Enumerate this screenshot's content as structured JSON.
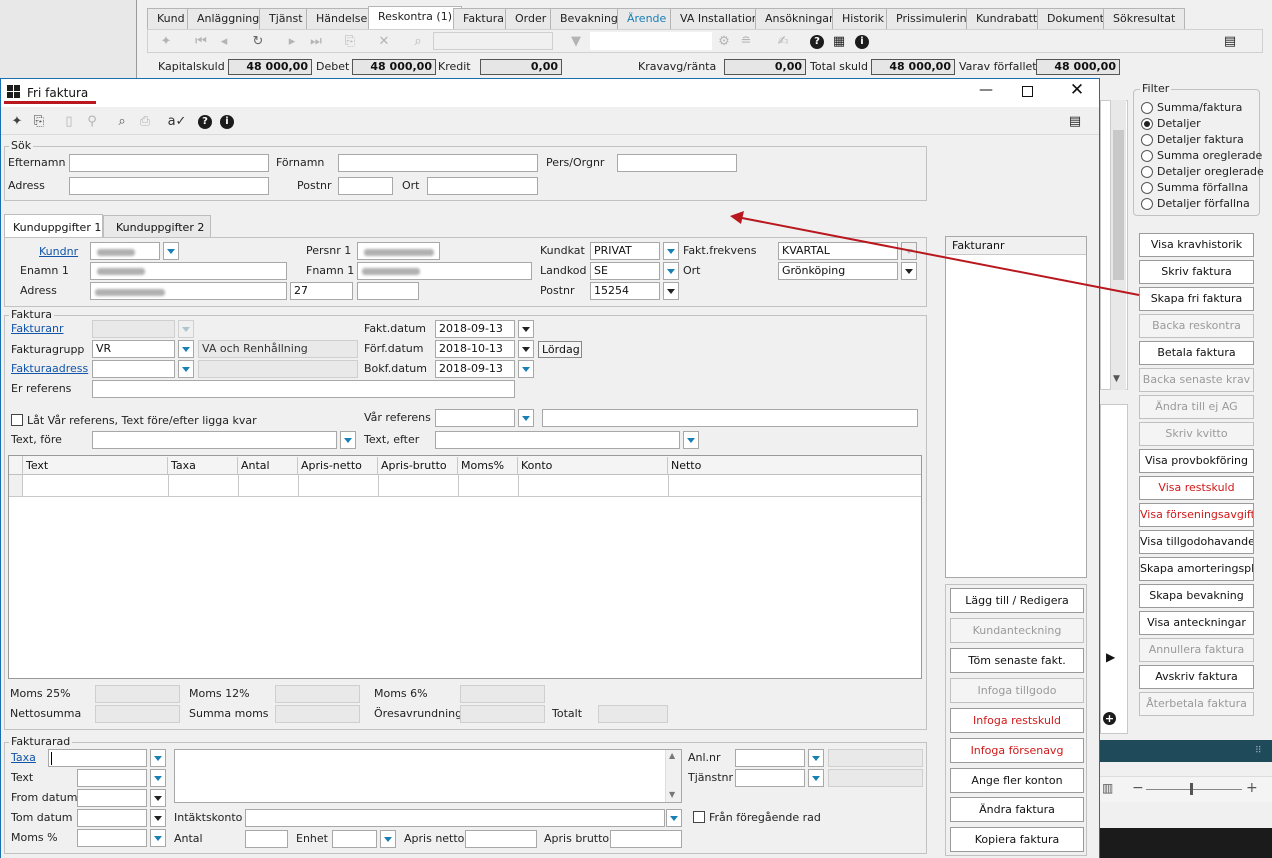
{
  "parent": {
    "tabs": [
      "Kund",
      "Anläggning",
      "Tjänst",
      "Händelse",
      "Reskontra (1)",
      "Faktura",
      "Order",
      "Bevakning",
      "Ärende",
      "VA Installation",
      "Ansökningar",
      "Historik",
      "Prissimulering",
      "Kundrabatt",
      "Dokument",
      "Sökresultat"
    ],
    "active_tab": "Reskontra (1)",
    "summary": {
      "kapitalskuld_label": "Kapitalskuld",
      "kapitalskuld": "48 000,00",
      "debet_label": "Debet",
      "debet": "48 000,00",
      "kredit_label": "Kredit",
      "kredit": "0,00",
      "kravavg_label": "Kravavg/ränta",
      "kravavg": "0,00",
      "total_label": "Total skuld",
      "total": "48 000,00",
      "forfallet_label": "Varav förfallet",
      "forfallet": "48 000,00"
    },
    "filter": {
      "title": "Filter",
      "options": [
        "Summa/faktura",
        "Detaljer",
        "Detaljer faktura",
        "Summa oreglerade",
        "Detaljer oreglerade",
        "Summa förfallna",
        "Detaljer förfallna"
      ],
      "selected": "Detaljer"
    },
    "buttons": [
      {
        "label": "Visa kravhistorik",
        "state": "normal"
      },
      {
        "label": "Skriv faktura",
        "state": "normal"
      },
      {
        "label": "Skapa fri faktura",
        "state": "normal"
      },
      {
        "label": "Backa reskontra",
        "state": "disabled"
      },
      {
        "label": "Betala faktura",
        "state": "normal"
      },
      {
        "label": "Backa senaste krav",
        "state": "disabled"
      },
      {
        "label": "Ändra till ej AG",
        "state": "disabled"
      },
      {
        "label": "Skriv kvitto",
        "state": "disabled"
      },
      {
        "label": "Visa provbokföring",
        "state": "normal"
      },
      {
        "label": "Visa restskuld",
        "state": "red"
      },
      {
        "label": "Visa förseningsavgift",
        "state": "red"
      },
      {
        "label": "Visa tillgodohavande",
        "state": "normal"
      },
      {
        "label": "Skapa amorteringsplan",
        "state": "normal"
      },
      {
        "label": "Skapa bevakning",
        "state": "normal"
      },
      {
        "label": "Visa anteckningar",
        "state": "normal"
      },
      {
        "label": "Annullera faktura",
        "state": "disabled"
      },
      {
        "label": "Avskriv faktura",
        "state": "normal"
      },
      {
        "label": "Återbetala faktura",
        "state": "disabled"
      }
    ]
  },
  "dialog": {
    "title": "Fri faktura",
    "sok": {
      "title": "Sök",
      "efternamn_label": "Efternamn",
      "fornamn_label": "Förnamn",
      "persorgnr_label": "Pers/Orgnr",
      "adress_label": "Adress",
      "postnr_label": "Postnr",
      "ort_label": "Ort"
    },
    "tabs": [
      "Kunduppgifter 1",
      "Kunduppgifter 2"
    ],
    "kund": {
      "kundnr_label": "Kundnr",
      "enamn_label": "Enamn 1",
      "adress_label": "Adress",
      "persnr_label": "Persnr 1",
      "fnamn_label": "Fnamn 1",
      "address_number": "27",
      "kundkat_label": "Kundkat",
      "kundkat": "PRIVAT",
      "landkod_label": "Landkod",
      "landkod": "SE",
      "postnr_label": "Postnr",
      "postnr": "15254",
      "faktfrekvens_label": "Fakt.frekvens",
      "faktfrekvens": "KVARTAL",
      "ort_label": "Ort",
      "ort": "Grönköping"
    },
    "faktura": {
      "title": "Faktura",
      "fakturanr_label": "Fakturanr",
      "fakturagrupp_label": "Fakturagrupp",
      "fakturagrupp": "VR",
      "fakturagrupp_desc": "VA och Renhållning",
      "fakturaadress_label": "Fakturaadress",
      "er_referens_label": "Er referens",
      "faktdatum_label": "Fakt.datum",
      "faktdatum": "2018-09-13",
      "forfdatum_label": "Förf.datum",
      "forfdatum": "2018-10-13",
      "weekday": "Lördag",
      "bokfdatum_label": "Bokf.datum",
      "bokfdatum": "2018-09-13",
      "lat_label": "Låt Vår referens, Text före/efter ligga kvar",
      "var_referens_label": "Vår referens",
      "text_fore_label": "Text, före",
      "text_efter_label": "Text, efter",
      "columns": [
        "Text",
        "Taxa",
        "Antal",
        "Apris-netto",
        "Apris-brutto",
        "Moms%",
        "Konto",
        "Netto"
      ],
      "moms25_label": "Moms 25%",
      "moms12_label": "Moms 12%",
      "moms6_label": "Moms 6%",
      "nettosumma_label": "Nettosumma",
      "summa_moms_label": "Summa moms",
      "oresavrundning_label": "Öresavrundning",
      "totalt_label": "Totalt"
    },
    "fakturanr_list_header": "Fakturanr",
    "fakturarad": {
      "title": "Fakturarad",
      "taxa_label": "Taxa",
      "text_label": "Text",
      "from_datum_label": "From datum",
      "tom_datum_label": "Tom datum",
      "moms_label": "Moms %",
      "intaktskonto_label": "Intäktskonto",
      "antal_label": "Antal",
      "enhet_label": "Enhet",
      "apris_netto_label": "Apris netto",
      "apris_brutto_label": "Apris brutto",
      "anlnr_label": "Anl.nr",
      "tjanstnr_label": "Tjänstnr",
      "fran_label": "Från föregående rad"
    },
    "buttons": [
      {
        "label": "Lägg till / Redigera",
        "state": "normal"
      },
      {
        "label": "Kundanteckning",
        "state": "disabled"
      },
      {
        "label": "Töm senaste fakt.",
        "state": "normal"
      },
      {
        "label": "Infoga tillgodo",
        "state": "disabled"
      },
      {
        "label": "Infoga restskuld",
        "state": "red"
      },
      {
        "label": "Infoga försenavg",
        "state": "red"
      },
      {
        "label": "Ange fler konton",
        "state": "normal"
      },
      {
        "label": "Ändra faktura",
        "state": "normal"
      },
      {
        "label": "Kopiera faktura",
        "state": "normal"
      }
    ]
  },
  "colors": {
    "annotation_red": "#b8181e",
    "disabled_text": "#9a9a9a",
    "red_text": "#d01818"
  }
}
